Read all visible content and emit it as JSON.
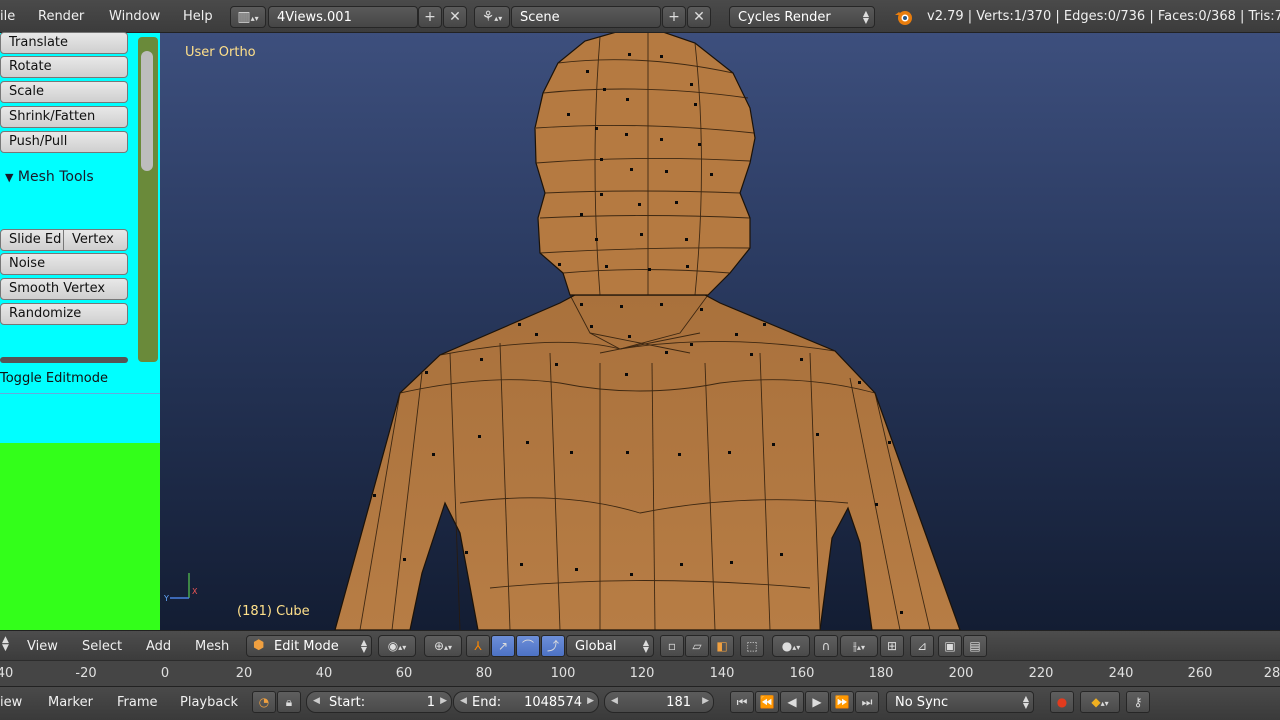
{
  "topbar": {
    "menus": [
      "ile",
      "Render",
      "Window",
      "Help"
    ],
    "layout_name": "4Views.001",
    "scene_name": "Scene",
    "render_engine": "Cycles Render",
    "stats": "v2.79 | Verts:1/370 | Edges:0/736 | Faces:0/368 | Tris:7"
  },
  "tool_shelf": {
    "transform_buttons": [
      "Translate",
      "Rotate",
      "Scale",
      "Shrink/Fatten",
      "Push/Pull"
    ],
    "mesh_tools_label": "Mesh Tools",
    "slide_edge_label": "Slide Ed",
    "vertex_label": "Vertex",
    "deform_buttons": [
      "Noise",
      "Smooth Vertex",
      "Randomize"
    ],
    "toggle_editmode_label": "Toggle Editmode"
  },
  "viewport": {
    "view_label": "User Ortho",
    "object_label": "(181) Cube"
  },
  "header3d": {
    "menus": [
      "View",
      "Select",
      "Add",
      "Mesh"
    ],
    "mode": "Edit Mode",
    "orientation": "Global"
  },
  "timeline_ruler": {
    "ticks": [
      "40",
      "-20",
      "0",
      "20",
      "40",
      "60",
      "80",
      "100",
      "120",
      "140",
      "160",
      "180",
      "200",
      "220",
      "240",
      "260",
      "28"
    ]
  },
  "timeline": {
    "menus": [
      "iew",
      "Marker",
      "Frame",
      "Playback"
    ],
    "start_label": "Start:",
    "start_value": "1",
    "end_label": "End:",
    "end_value": "1048574",
    "current_frame": "181",
    "sync_mode": "No Sync"
  },
  "colors": {
    "shelf_cyan": "#00ffff",
    "shelf_green": "#33ff1a",
    "mesh_skin": "#b0763e",
    "accent_blue": "#5680c2",
    "record_red": "#e23b1e"
  }
}
